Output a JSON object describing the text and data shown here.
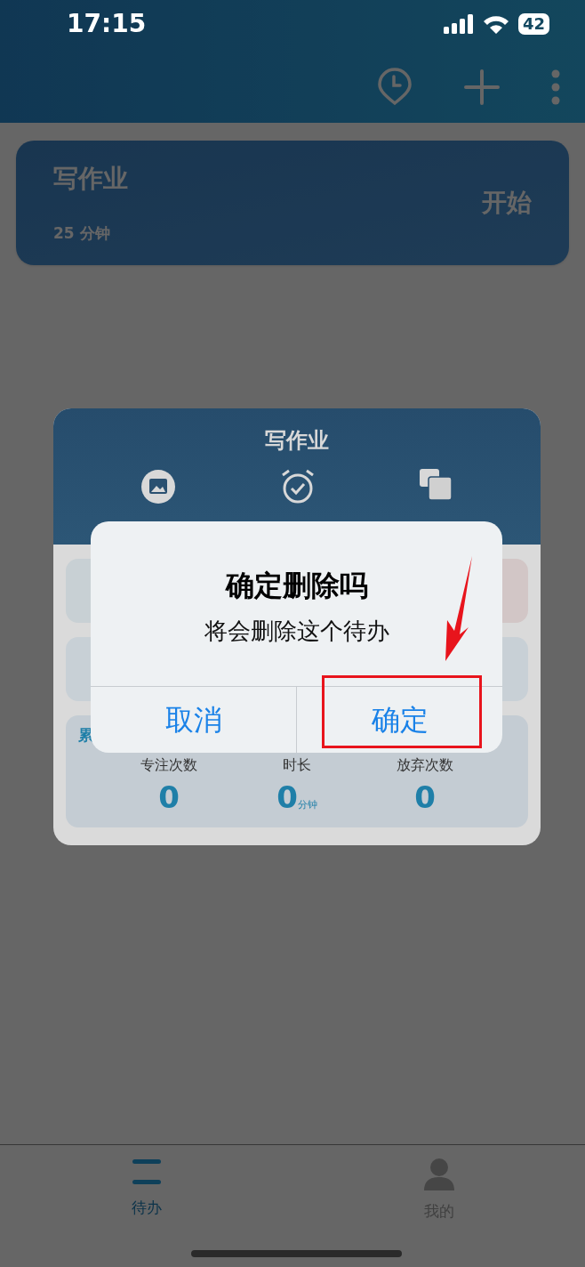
{
  "status_bar": {
    "time": "17:15",
    "battery": "42"
  },
  "tasks": [
    {
      "title": "写作业",
      "duration": "25 分钟",
      "action": "开始"
    }
  ],
  "sheet": {
    "title": "写作业"
  },
  "stats": {
    "heading": "累",
    "items": [
      {
        "label": "专注次数",
        "value": "0"
      },
      {
        "label": "时长",
        "value": "0",
        "unit": "分钟"
      },
      {
        "label": "放弃次数",
        "value": "0"
      }
    ]
  },
  "dialog": {
    "title": "确定删除吗",
    "message": "将会删除这个待办",
    "buttons": [
      "取消",
      "确定"
    ]
  },
  "tab_bar": [
    {
      "label": "待办",
      "selected": true
    },
    {
      "label": "我的",
      "selected": false
    }
  ]
}
